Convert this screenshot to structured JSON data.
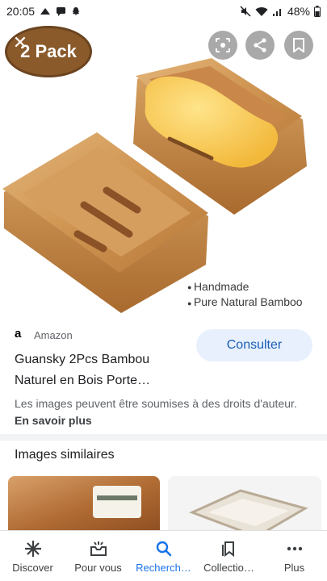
{
  "status_bar": {
    "time": "20:05",
    "battery": "48%"
  },
  "hero": {
    "badge_text": "2 Pack",
    "features": [
      "Handmade",
      "Pure Natural Bamboo"
    ],
    "icons": [
      "close-icon",
      "lens-icon",
      "share-icon",
      "bookmark-icon"
    ]
  },
  "result": {
    "source": "Amazon",
    "title": "Guansky 2Pcs Bambou Naturel en Bois Porte…",
    "visit_label": "Consulter",
    "copyright_text": "Les images peuvent être soumises à des droits d'auteur.",
    "learn_more": "En savoir plus"
  },
  "similar": {
    "heading": "Images similaires"
  },
  "bottom_nav": {
    "items": [
      {
        "label": "Discover",
        "icon": "asterisk-icon"
      },
      {
        "label": "Pour vous",
        "icon": "inbox-icon"
      },
      {
        "label": "Recherch…",
        "icon": "search-icon"
      },
      {
        "label": "Collectio…",
        "icon": "collections-icon"
      },
      {
        "label": "Plus",
        "icon": "more-icon"
      }
    ],
    "active_index": 2
  },
  "colors": {
    "accent": "#1a73e8",
    "visit_bg": "#e8f0fe",
    "badge": "#8a5a2b"
  }
}
